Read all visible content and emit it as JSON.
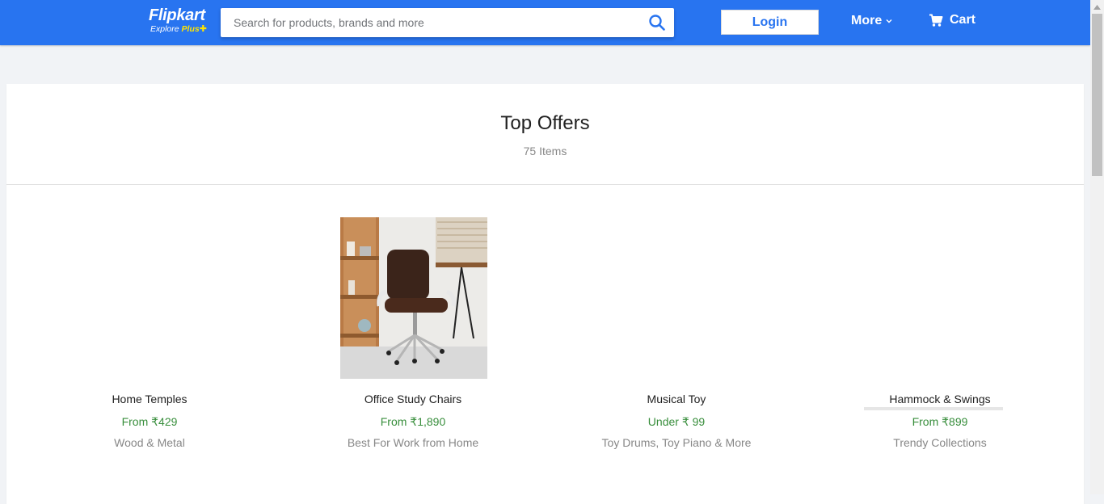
{
  "header": {
    "logo": {
      "word": "Flipkart",
      "tag_prefix": "Explore",
      "tag_plus": "Plus",
      "tag_icon": "✚"
    },
    "search": {
      "placeholder": "Search for products, brands and more",
      "value": ""
    },
    "login_label": "Login",
    "more_label": "More",
    "cart_label": "Cart",
    "brand_color": "#2874f0"
  },
  "offers": {
    "title": "Top Offers",
    "count": "75 Items",
    "items": [
      {
        "name": "Home Temples",
        "price": "From ₹429",
        "sub": "Wood & Metal",
        "has_image": false
      },
      {
        "name": "Office Study Chairs",
        "price": "From ₹1,890",
        "sub": "Best For Work from Home",
        "has_image": true
      },
      {
        "name": "Musical Toy",
        "price": "Under ₹ 99",
        "sub": "Toy Drums, Toy Piano & More",
        "has_image": false
      },
      {
        "name": "Hammock & Swings",
        "price": "From ₹899",
        "sub": "Trendy Collections",
        "has_image": false
      }
    ]
  },
  "icons": {
    "search": "search-icon",
    "chevron": "chevron-down-icon",
    "cart": "cart-icon"
  },
  "colors": {
    "price_green": "#388e3c",
    "muted_gray": "#878787"
  }
}
